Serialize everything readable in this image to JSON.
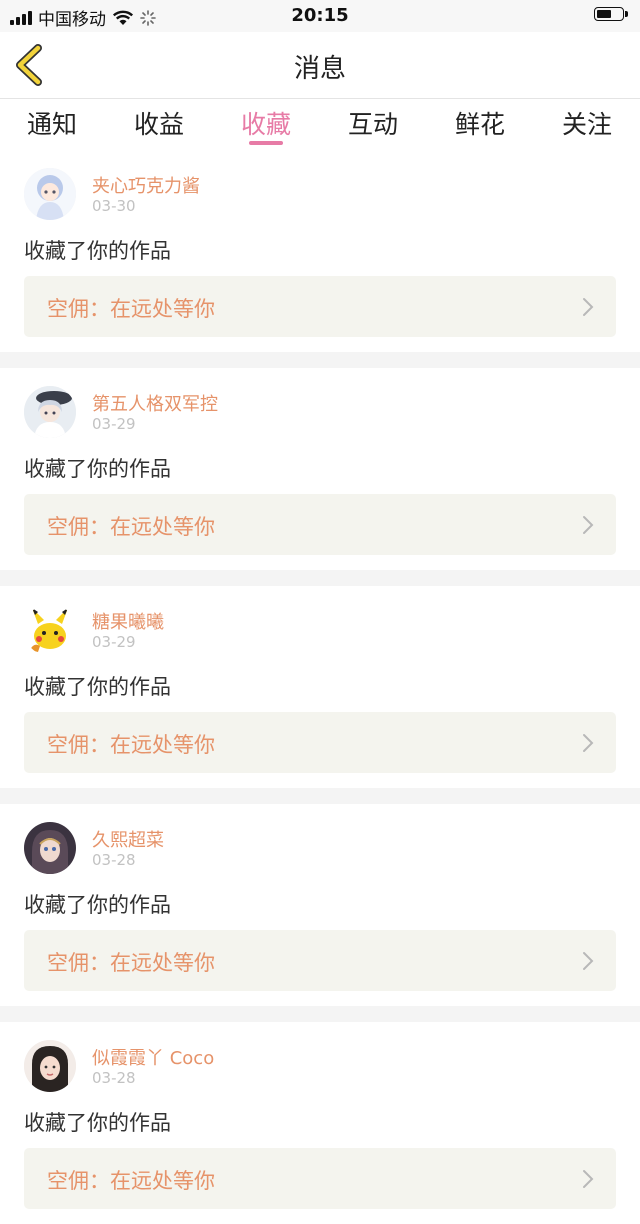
{
  "status_bar": {
    "carrier": "中国移动",
    "time": "20:15",
    "battery_level": 0.6
  },
  "nav": {
    "title": "消息",
    "back_icon": "chevron-left-icon",
    "accent_color": "#f2d33a"
  },
  "tabs": [
    {
      "label": "通知",
      "active": false
    },
    {
      "label": "收益",
      "active": false
    },
    {
      "label": "收藏",
      "active": true
    },
    {
      "label": "互动",
      "active": false
    },
    {
      "label": "鲜花",
      "active": false
    },
    {
      "label": "关注",
      "active": false
    }
  ],
  "colors": {
    "active_tab": "#e77ba6",
    "username": "#e6936a",
    "link_bg": "#f4f4ee"
  },
  "messages": [
    {
      "username": "夹心巧克力酱",
      "date": "03-30",
      "text": "收藏了你的作品",
      "work_title": "空佣：在远处等你",
      "avatar_icon": "anime-avatar-icon"
    },
    {
      "username": "第五人格双军控",
      "date": "03-29",
      "text": "收藏了你的作品",
      "work_title": "空佣：在远处等你",
      "avatar_icon": "anime-avatar-icon"
    },
    {
      "username": "糖果曦曦",
      "date": "03-29",
      "text": "收藏了你的作品",
      "work_title": "空佣：在远处等你",
      "avatar_icon": "pikachu-avatar-icon"
    },
    {
      "username": "久熙超菜",
      "date": "03-28",
      "text": "收藏了你的作品",
      "work_title": "空佣：在远处等你",
      "avatar_icon": "anime-avatar-icon"
    },
    {
      "username": "似霞霞丫 Coco",
      "date": "03-28",
      "text": "收藏了你的作品",
      "work_title": "空佣：在远处等你",
      "avatar_icon": "photo-avatar-icon"
    }
  ]
}
